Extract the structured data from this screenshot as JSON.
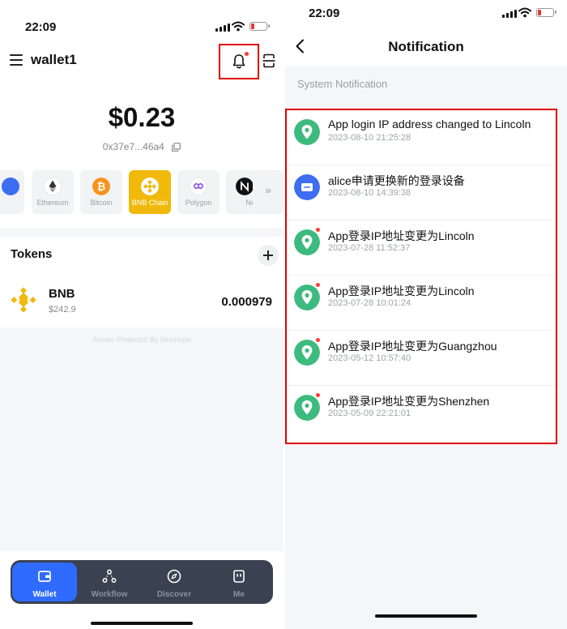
{
  "colors": {
    "accent_blue": "#2f6bff",
    "bnb_yellow": "#f0b90b",
    "location_green": "#3dba7e",
    "device_blue": "#3d6df0",
    "highlight_red": "#e00000",
    "dark_tabbar": "#3a4150"
  },
  "left_screen": {
    "status_time": "22:09",
    "wallet_name": "wallet1",
    "menu_icon": "hamburger-menu-icon",
    "bell_icon": "bell-icon",
    "scan_icon": "scan-icon",
    "balance": "$0.23",
    "address": "0x37e7...46a4",
    "chains": [
      {
        "label": "",
        "icon": "partial-chain-icon",
        "color": "#3d6df0"
      },
      {
        "label": "Ethereum",
        "icon": "ethereum-icon",
        "color": "#ffffff"
      },
      {
        "label": "Bitcoin",
        "icon": "bitcoin-icon",
        "color": "#f7931a"
      },
      {
        "label": "BNB Chain",
        "icon": "bnb-icon",
        "color": "#f0b90b"
      },
      {
        "label": "Polygon",
        "icon": "polygon-icon",
        "color": "#ffffff"
      },
      {
        "label": "Ne",
        "icon": "near-icon",
        "color": "#111111"
      }
    ],
    "chain_more": "»",
    "tokens_title": "Tokens",
    "tokens": [
      {
        "symbol": "BNB",
        "price": "$242.9",
        "amount": "0.000979",
        "icon": "bnb-token-icon"
      }
    ],
    "protected_text": "Assets Protected By Sinohope",
    "tabs": [
      {
        "label": "Wallet",
        "icon": "wallet-icon",
        "active": true
      },
      {
        "label": "Workflow",
        "icon": "workflow-icon",
        "active": false
      },
      {
        "label": "Discover",
        "icon": "compass-icon",
        "active": false
      },
      {
        "label": "Me",
        "icon": "profile-icon",
        "active": false
      }
    ]
  },
  "right_screen": {
    "status_time": "22:09",
    "title": "Notification",
    "section": "System Notification",
    "notifications": [
      {
        "title": "App login IP address changed to Lincoln",
        "time": "2023-08-10 21:25:28",
        "icon": "location-pin-icon",
        "unread": false
      },
      {
        "title": "alice申请更换新的登录设备",
        "time": "2023-08-10 14:39:38",
        "icon": "device-icon",
        "unread": false
      },
      {
        "title": "App登录IP地址变更为Lincoln",
        "time": "2023-07-28 11:52:37",
        "icon": "location-pin-icon",
        "unread": true
      },
      {
        "title": "App登录IP地址变更为Lincoln",
        "time": "2023-07-28 10:01:24",
        "icon": "location-pin-icon",
        "unread": true
      },
      {
        "title": "App登录IP地址变更为Guangzhou",
        "time": "2023-05-12 10:57:40",
        "icon": "location-pin-icon",
        "unread": true
      },
      {
        "title": "App登录IP地址变更为Shenzhen",
        "time": "2023-05-09 22:21:01",
        "icon": "location-pin-icon",
        "unread": true
      }
    ]
  }
}
